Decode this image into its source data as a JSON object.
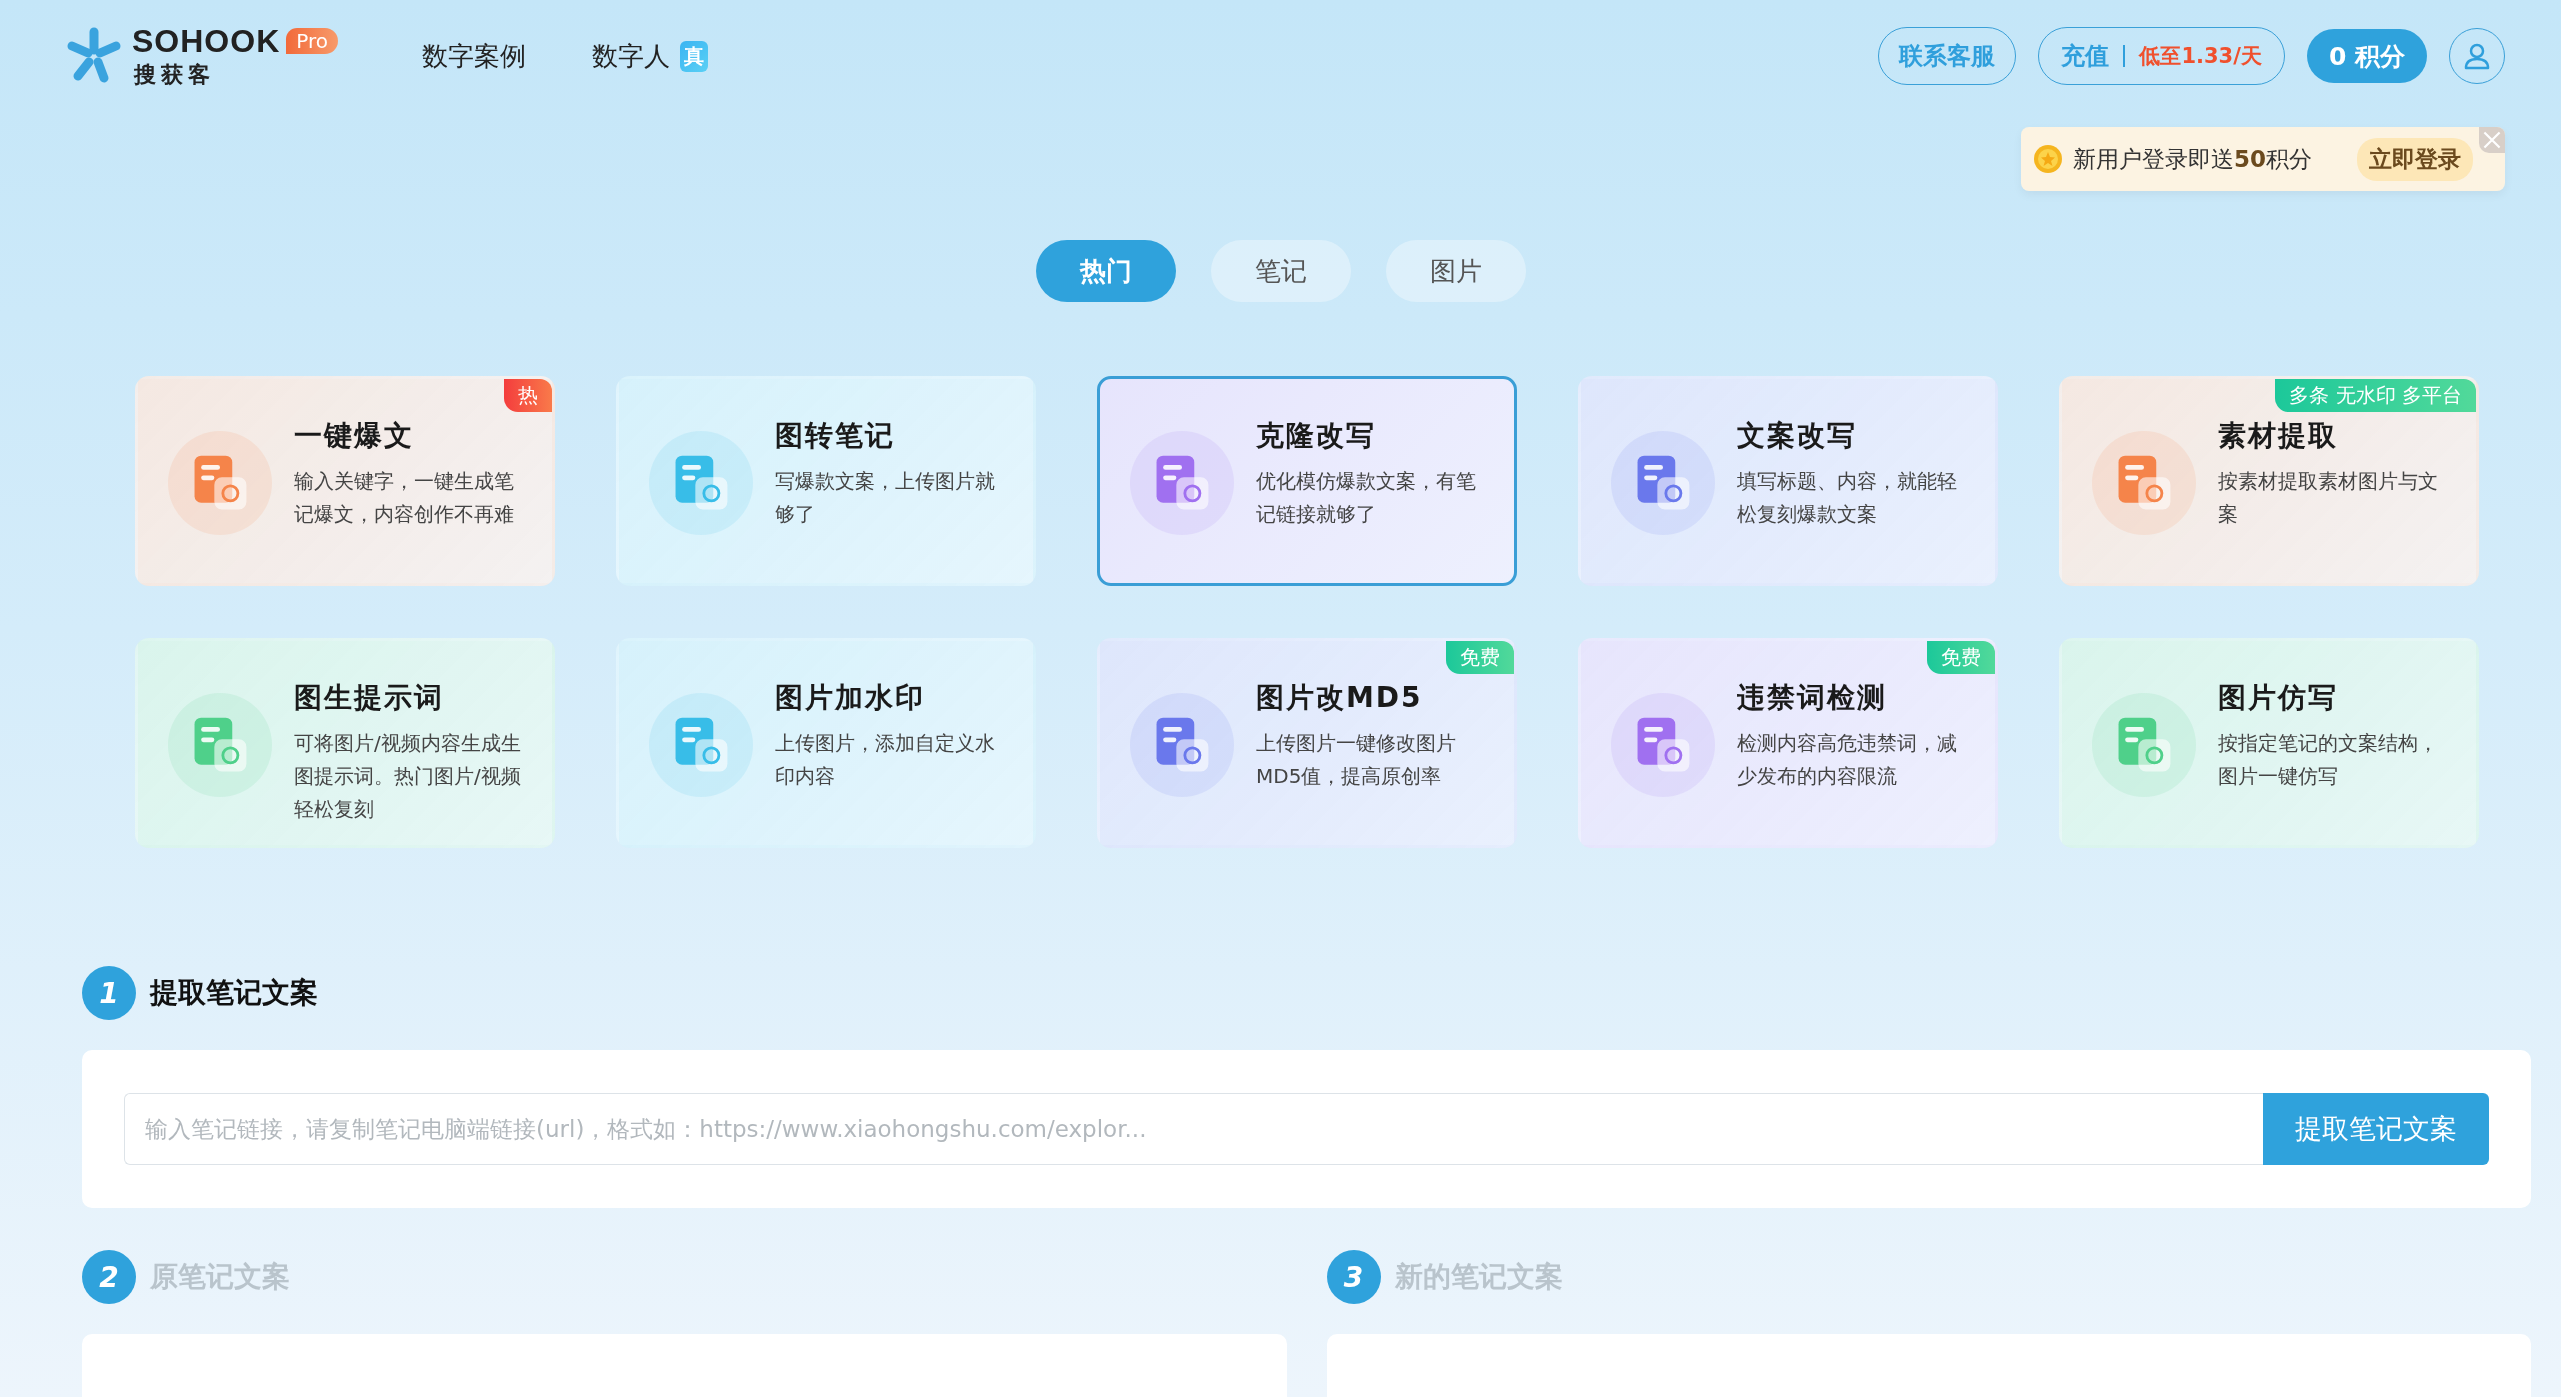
{
  "header": {
    "logo": {
      "brand": "SOHOOK",
      "badge": "Pro",
      "subtitle": "搜获客"
    },
    "nav": [
      {
        "label": "数字案例"
      },
      {
        "label": "数字人",
        "badge": "真"
      }
    ],
    "contact_button": "联系客服",
    "recharge_button": {
      "label": "充值",
      "promo": "低至1.33/天"
    },
    "points_button": "0 积分",
    "login_popup": {
      "text": "新用户登录即送**50**积分",
      "action": "立即登录"
    }
  },
  "tabs": [
    {
      "label": "热门",
      "selected": true
    },
    {
      "label": "笔记",
      "selected": false
    },
    {
      "label": "图片",
      "selected": false
    }
  ],
  "tools": [
    {
      "title": "一键爆文",
      "description": "输入关键字，一键生成笔记爆文，内容创作不再难",
      "color": "#f5844a",
      "selected": false,
      "badge": {
        "kind": "hot",
        "text": "热"
      }
    },
    {
      "title": "图转笔记",
      "description": "写爆款文案，上传图片就够了",
      "color": "#38bde8",
      "selected": false
    },
    {
      "title": "克隆改写",
      "description": "优化模仿爆款文案，有笔记链接就够了",
      "color": "#a070f0",
      "selected": true
    },
    {
      "title": "文案改写",
      "description": "填写标题、内容，就能轻松复刻爆款文案",
      "color": "#6a78ec",
      "selected": false
    },
    {
      "title": "素材提取",
      "description": "按素材提取素材图片与文案",
      "color": "#f5844a",
      "selected": false,
      "badge": {
        "kind": "free",
        "text": "多条  无水印  多平台"
      }
    },
    {
      "title": "图生提示词",
      "description": "可将图片/视频内容生成生图提示词。热门图片/视频轻松复刻",
      "color": "#4fd08a",
      "selected": false
    },
    {
      "title": "图片加水印",
      "description": "上传图片，添加自定义水印内容",
      "color": "#38bde8",
      "selected": false
    },
    {
      "title": "图片改MD5",
      "description": "上传图片一键修改图片MD5值，提高原创率",
      "color": "#6a78ec",
      "selected": false,
      "badge": {
        "kind": "free",
        "text": "免费"
      }
    },
    {
      "title": "违禁词检测",
      "description": "检测内容高危违禁词，减少发布的内容限流",
      "color": "#a070f0",
      "selected": false,
      "badge": {
        "kind": "free",
        "text": "免费"
      }
    },
    {
      "title": "图片仿写",
      "description": "按指定笔记的文案结构，图片一键仿写",
      "color": "#4fd08a",
      "selected": false
    }
  ],
  "steps": [
    {
      "number": "1",
      "title": "提取笔记文案",
      "disabled": false
    },
    {
      "number": "2",
      "title": "原笔记文案",
      "disabled": true
    },
    {
      "number": "3",
      "title": "新的笔记文案",
      "disabled": true
    }
  ],
  "extract": {
    "placeholder": "输入笔记链接，请复制笔记电脑端链接(url)，格式如：https://www.xiaohongshu.com/explor...",
    "button": "提取笔记文案"
  }
}
